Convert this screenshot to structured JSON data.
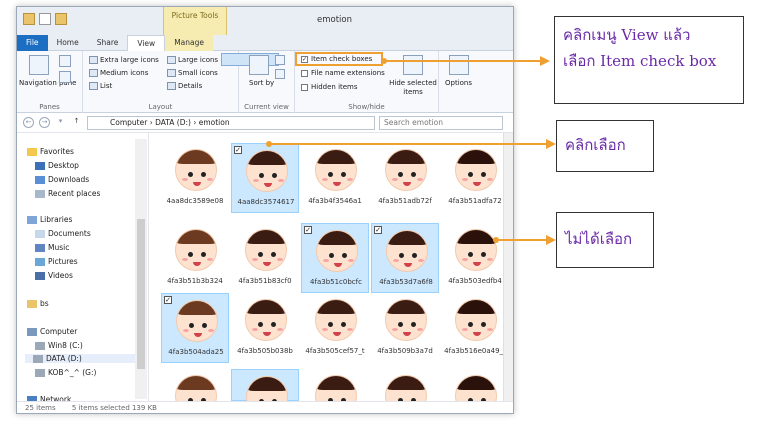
{
  "window": {
    "title": "emotion",
    "contextual_tab": "Picture Tools"
  },
  "tabs": [
    "File",
    "Home",
    "Share",
    "View",
    "Manage"
  ],
  "ribbon": {
    "panes": {
      "navigation_pane": "Navigation pane",
      "group_label": "Panes"
    },
    "layout": {
      "items": [
        "Extra large icons",
        "Large icons",
        "Medium icons",
        "Small icons",
        "List",
        "Details"
      ],
      "group_label": "Layout"
    },
    "current_view": {
      "sort_by": "Sort by",
      "group_label": "Current view"
    },
    "show_hide": {
      "item_check_boxes": "Item check boxes",
      "file_name_extensions": "File name extensions",
      "hidden_items": "Hidden items",
      "hide_selected_items": "Hide selected items",
      "group_label": "Show/hide"
    },
    "options": "Options"
  },
  "address": {
    "path": [
      "Computer",
      "DATA (D:)",
      "emotion"
    ],
    "search_placeholder": "Search emotion"
  },
  "nav": {
    "favorites": "Favorites",
    "favorites_items": [
      "Desktop",
      "Downloads",
      "Recent places"
    ],
    "libraries": "Libraries",
    "libraries_items": [
      "Documents",
      "Music",
      "Pictures",
      "Videos"
    ],
    "bs": "bs",
    "computer": "Computer",
    "computer_items": [
      "Win8 (C:)",
      "DATA (D:)",
      "KOB^_^ (G:)"
    ],
    "network": "Network"
  },
  "files": [
    {
      "name": "4aa8dc3589e08",
      "selected": false,
      "checked": false
    },
    {
      "name": "4aa8dc3574617",
      "selected": true,
      "checked": true
    },
    {
      "name": "4fa3b4f3546a1",
      "selected": false,
      "checked": false
    },
    {
      "name": "4fa3b51adb72f",
      "selected": false,
      "checked": false
    },
    {
      "name": "4fa3b51adfa72",
      "selected": false,
      "checked": false
    },
    {
      "name": "4fa3b51b3b324",
      "selected": false,
      "checked": false
    },
    {
      "name": "4fa3b51b83cf0",
      "selected": false,
      "checked": false
    },
    {
      "name": "4fa3b51c0bcfc",
      "selected": true,
      "checked": true
    },
    {
      "name": "4fa3b53d7a6f8",
      "selected": true,
      "checked": true
    },
    {
      "name": "4fa3b503edfb4",
      "selected": false,
      "checked": false
    },
    {
      "name": "4fa3b504ada25",
      "selected": true,
      "checked": true
    },
    {
      "name": "4fa3b505b038b",
      "selected": false,
      "checked": false
    },
    {
      "name": "4fa3b505cef57_t",
      "selected": false,
      "checked": false
    },
    {
      "name": "4fa3b509b3a7d",
      "selected": false,
      "checked": false
    },
    {
      "name": "4fa3b516e0a49_t",
      "selected": false,
      "checked": false
    },
    {
      "name": "",
      "selected": false,
      "checked": false
    },
    {
      "name": "",
      "selected": true,
      "checked": false
    },
    {
      "name": "",
      "selected": false,
      "checked": false
    },
    {
      "name": "",
      "selected": false,
      "checked": false
    },
    {
      "name": "",
      "selected": false,
      "checked": false
    }
  ],
  "status": {
    "items": "25 items",
    "selected": "5 items selected  139 KB"
  },
  "callouts": {
    "view_menu": "คลิกเมนู View  แล้ว",
    "view_menu_2": "เลือก Item check  box",
    "click_select": "คลิกเลือก",
    "not_selected": "ไม่ได้เลือก"
  },
  "colors": {
    "accent": "#1b6ec2",
    "highlight_orange": "#f0a030",
    "callout_text": "#6a2ba8",
    "selection": "#cce8ff"
  }
}
